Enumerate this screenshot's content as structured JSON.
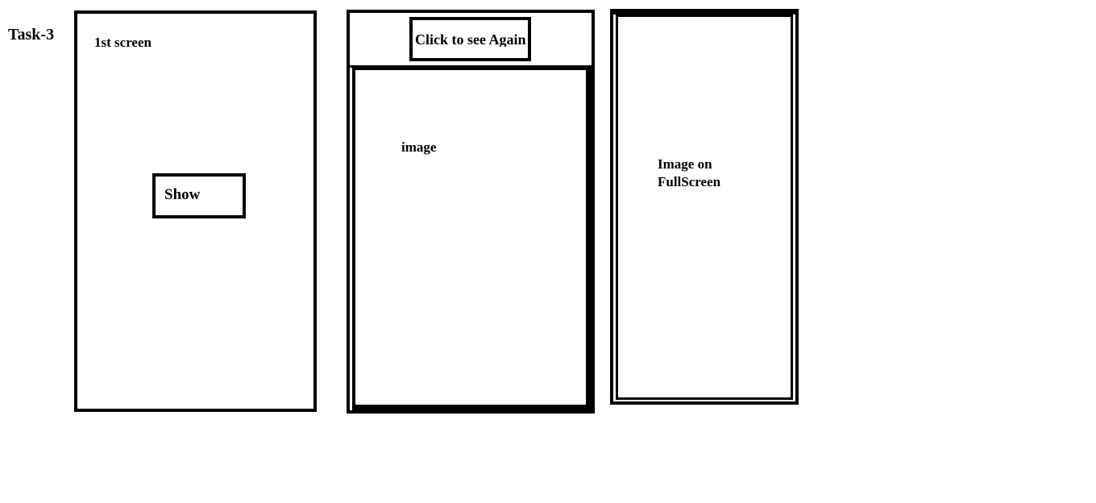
{
  "title": "Task-3",
  "screen1": {
    "label": "1st screen",
    "button_label": "Show"
  },
  "screen2": {
    "button_label": "Click to see Again",
    "image_label": "image"
  },
  "screen3": {
    "label": "Image on\nFullScreen"
  }
}
